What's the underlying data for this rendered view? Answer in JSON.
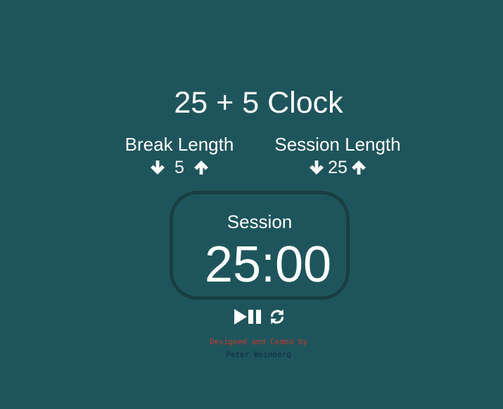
{
  "app": {
    "title": "25 + 5 Clock"
  },
  "break": {
    "label": "Break Length",
    "value": "5",
    "decrement_icon": "arrow-down-icon",
    "increment_icon": "arrow-up-icon"
  },
  "session": {
    "label": "Session Length",
    "value": "25",
    "decrement_icon": "arrow-down-icon",
    "increment_icon": "arrow-up-icon"
  },
  "timer": {
    "label": "Session",
    "time": "25:00"
  },
  "controls": {
    "play_pause_icon": "play-pause-icon",
    "reset_icon": "refresh-icon"
  },
  "footer": {
    "line1": "Designed and Coded by",
    "line2": "Peter Weinberg"
  },
  "colors": {
    "background": "#1e555c",
    "timer_border": "#183e42",
    "text": "#ffffff",
    "credit_line1": "#c0392b",
    "credit_line2": "#0e2a44"
  }
}
